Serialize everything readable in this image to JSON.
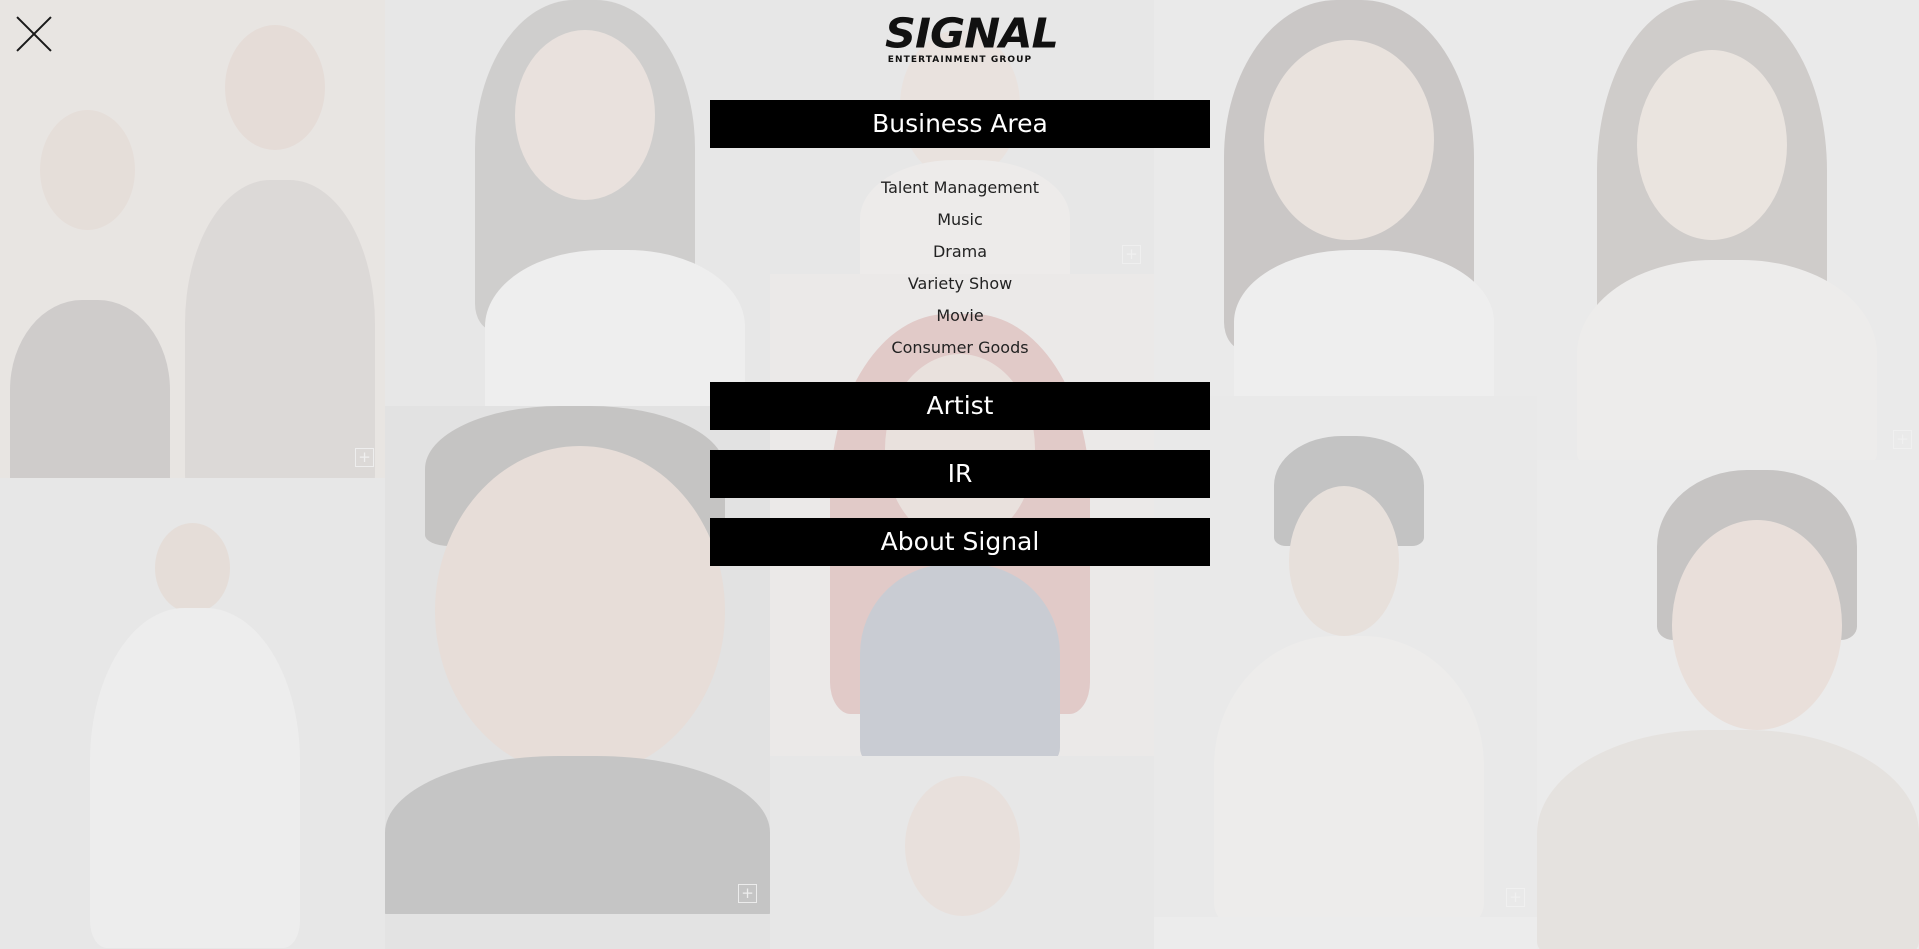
{
  "header": {
    "close_icon": "close-x-icon",
    "logo": {
      "wordmark": "SIGNAL",
      "subtitle": "ENTERTAINMENT GROUP"
    }
  },
  "menu": {
    "sections": [
      {
        "label": "Business Area",
        "items": [
          "Talent Management",
          "Music",
          "Drama",
          "Variety Show",
          "Movie",
          "Consumer Goods"
        ]
      },
      {
        "label": "Artist"
      },
      {
        "label": "IR"
      },
      {
        "label": "About Signal"
      }
    ]
  },
  "background": {
    "expand_icon": "plus-icon",
    "tile_symbol": "+"
  },
  "colors": {
    "bar_background": "#000000",
    "bar_text": "#ffffff",
    "submenu_text": "#222222",
    "overlay": "#ececec"
  }
}
